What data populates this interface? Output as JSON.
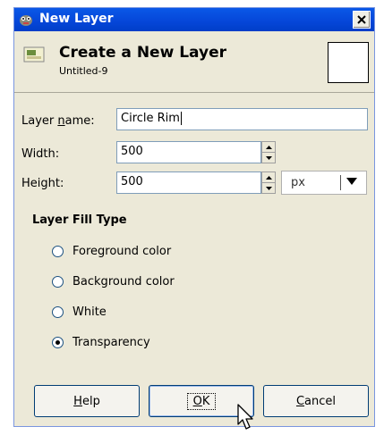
{
  "window": {
    "title": "New Layer",
    "app_icon": "gimp-icon",
    "close_icon": "close-icon"
  },
  "header": {
    "title": "Create a New Layer",
    "subtitle": "Untitled-9",
    "icon": "layer-icon"
  },
  "form": {
    "layer_name_label_pre": "Layer ",
    "layer_name_label_u": "n",
    "layer_name_label_post": "ame:",
    "layer_name_value": "Circle Rim",
    "width_label": "Width:",
    "width_value": "500",
    "height_label": "Height:",
    "height_value": "500",
    "unit_value": "px"
  },
  "fill": {
    "title": "Layer Fill Type",
    "options": [
      {
        "label": "Foreground color",
        "selected": false
      },
      {
        "label": "Background color",
        "selected": false
      },
      {
        "label": "White",
        "selected": false
      },
      {
        "label": "Transparency",
        "selected": true
      }
    ]
  },
  "buttons": {
    "help_u": "H",
    "help_rest": "elp",
    "ok_u": "O",
    "ok_rest": "K",
    "cancel_u": "C",
    "cancel_rest": "ancel"
  },
  "colors": {
    "titlebar": "#0546d8",
    "dialog_bg": "#ece9d8",
    "field_border": "#7f9db9"
  }
}
